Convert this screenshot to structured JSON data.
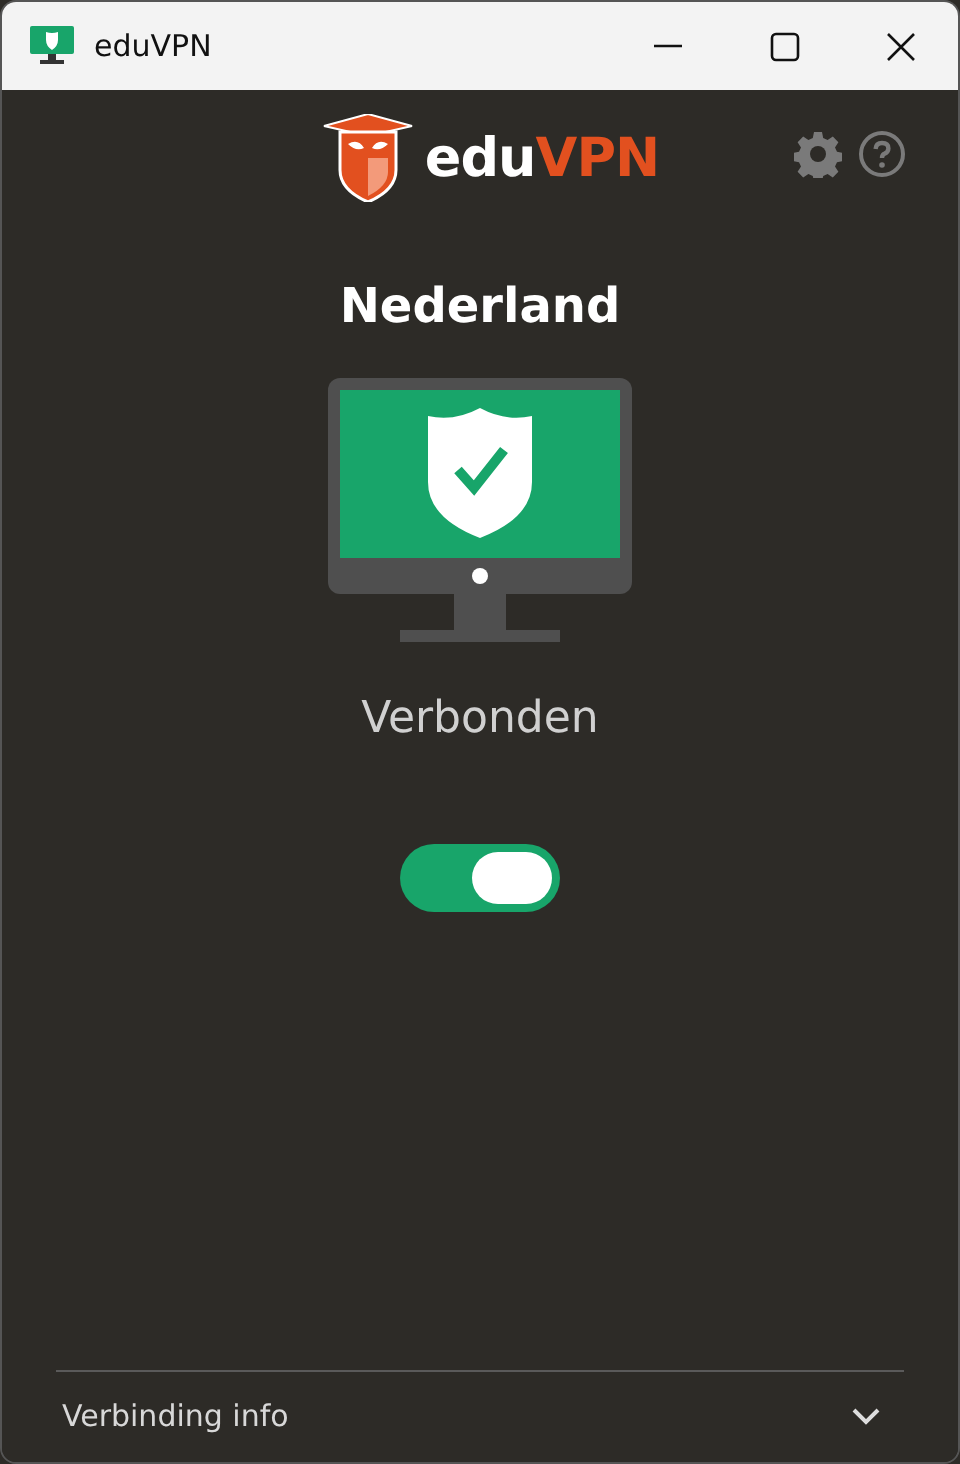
{
  "window": {
    "title": "eduVPN"
  },
  "logo": {
    "text_1": "edu",
    "text_2": "VPN"
  },
  "server": {
    "name": "Nederland"
  },
  "status": {
    "text": "Verbonden",
    "connected": true
  },
  "toggle": {
    "on": true
  },
  "connection_info": {
    "label": "Verbinding info",
    "expanded": false
  }
}
